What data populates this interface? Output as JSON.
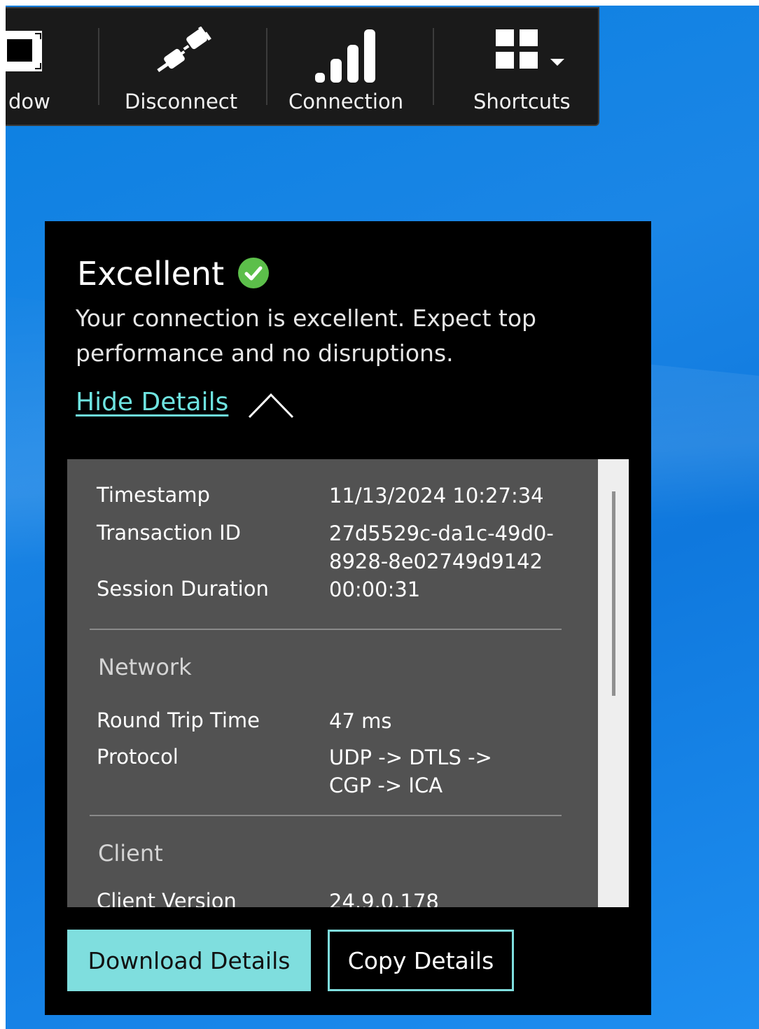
{
  "toolbar": {
    "items": [
      {
        "label": "dow",
        "icon": "window-icon"
      },
      {
        "label": "Disconnect",
        "icon": "plug-icon"
      },
      {
        "label": "Connection",
        "icon": "signal-bars-icon"
      },
      {
        "label": "Shortcuts",
        "icon": "grid-icon"
      }
    ]
  },
  "status": {
    "title": "Excellent",
    "description": "Your connection is excellent. Expect top performance and no disruptions.",
    "toggle_label": "Hide Details",
    "check_color": "#5cbf4a"
  },
  "details": {
    "rows": [
      {
        "label": "Timestamp",
        "value": "11/13/2024 10:27:34"
      },
      {
        "label": "Transaction ID",
        "value": "27d5529c-da1c-49d0-8928-8e02749d9142"
      },
      {
        "label": "Session Duration",
        "value": "00:00:31"
      }
    ],
    "network": {
      "title": "Network",
      "rows": [
        {
          "label": "Round Trip Time",
          "value": "47 ms"
        },
        {
          "label": "Protocol",
          "value": "UDP -> DTLS -> CGP -> ICA"
        }
      ]
    },
    "client": {
      "title": "Client",
      "rows": [
        {
          "label": "Client Version",
          "value": "24.9.0.178"
        }
      ]
    }
  },
  "buttons": {
    "download": "Download Details",
    "copy": "Copy Details"
  },
  "colors": {
    "accent": "#7fdede",
    "panel_bg": "#000000",
    "details_bg": "#525252",
    "desktop_blue": "#1b86e6"
  }
}
